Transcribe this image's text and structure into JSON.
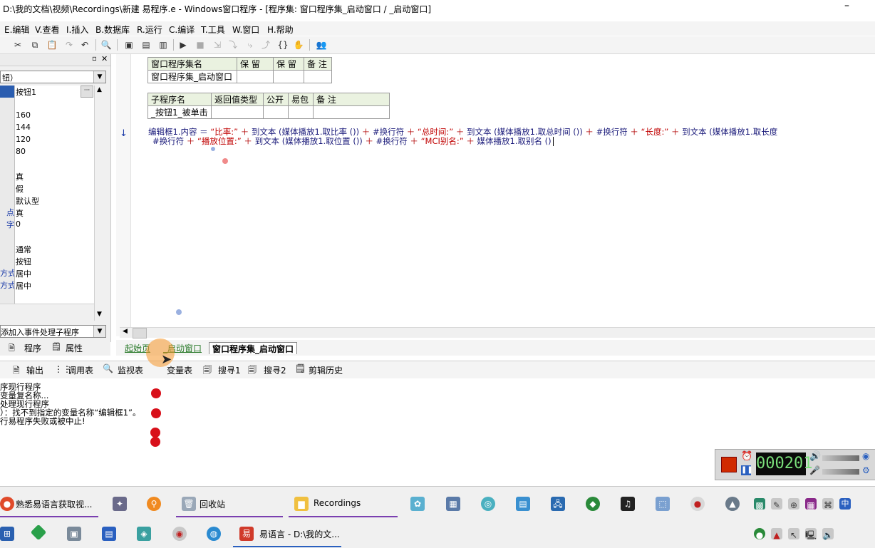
{
  "window": {
    "title": "D:\\我的文档\\视频\\Recordings\\新建 易程序.e - Windows窗口程序 - [程序集: 窗口程序集_启动窗口 / _启动窗口]",
    "minimize": "–"
  },
  "menu": [
    "E.编辑",
    "V.查看",
    "I.插入",
    "B.数据库",
    "R.运行",
    "C.编译",
    "T.工具",
    "W.窗口",
    "H.帮助"
  ],
  "left_panel": {
    "combo_value": "钮）",
    "properties": [
      {
        "key": "",
        "value": "按钮1",
        "selected": true
      },
      {
        "key": "",
        "value": ""
      },
      {
        "key": "",
        "value": "160"
      },
      {
        "key": "",
        "value": "144"
      },
      {
        "key": "",
        "value": "120"
      },
      {
        "key": "",
        "value": "80"
      },
      {
        "key": "",
        "value": ""
      },
      {
        "key": "",
        "value": "真"
      },
      {
        "key": "",
        "value": "假"
      },
      {
        "key": "",
        "value": "默认型"
      },
      {
        "key": "点",
        "value": "真"
      },
      {
        "key": "字",
        "value": "0"
      },
      {
        "key": "",
        "value": ""
      },
      {
        "key": "",
        "value": "通常"
      },
      {
        "key": "",
        "value": "按钮"
      },
      {
        "key": "方式",
        "value": "居中"
      },
      {
        "key": "方式",
        "value": "居中"
      },
      {
        "key": "",
        "value": ""
      }
    ],
    "event_combo": "添加入事件处理子程序",
    "tabs": [
      "程序",
      "属性"
    ],
    "ellipsis": "···"
  },
  "editor": {
    "assembly_table": {
      "headers": [
        "窗口程序集名",
        "保 留",
        "保 留",
        "备 注"
      ],
      "row": [
        "窗口程序集_启动窗口",
        "",
        "",
        ""
      ]
    },
    "sub_table": {
      "headers": [
        "子程序名",
        "返回值类型",
        "公开",
        "易包",
        "备 注"
      ],
      "row": [
        "_按钮1_被单击",
        "",
        "",
        "",
        ""
      ]
    },
    "code_line1": [
      {
        "t": "编辑框1.内容 ＝ ",
        "c": "kw"
      },
      {
        "t": "“比率:”",
        "c": "s"
      },
      {
        "t": " ＋ ",
        "c": "op"
      },
      {
        "t": "到文本 (媒体播放1.取比率 ()) ",
        "c": "kw"
      },
      {
        "t": "＋ ",
        "c": "op"
      },
      {
        "t": "#换行符 ",
        "c": "kw"
      },
      {
        "t": "＋ ",
        "c": "op"
      },
      {
        "t": "“总时间:”",
        "c": "s"
      },
      {
        "t": " ＋ ",
        "c": "op"
      },
      {
        "t": "到文本 (媒体播放1.取总时间 ()) ",
        "c": "kw"
      },
      {
        "t": "＋ ",
        "c": "op"
      },
      {
        "t": "#换行符 ",
        "c": "kw"
      },
      {
        "t": "＋ ",
        "c": "op"
      },
      {
        "t": "“长度:”",
        "c": "s"
      },
      {
        "t": " ＋ ",
        "c": "op"
      },
      {
        "t": "到文本 (媒体播放1.取长度",
        "c": "kw"
      }
    ],
    "code_line2": [
      {
        "t": "#换行符 ",
        "c": "kw"
      },
      {
        "t": "＋ ",
        "c": "op"
      },
      {
        "t": "“播放位置:”",
        "c": "s"
      },
      {
        "t": " ＋ ",
        "c": "op"
      },
      {
        "t": "到文本 (媒体播放1.取位置 ()) ",
        "c": "kw"
      },
      {
        "t": "＋ ",
        "c": "op"
      },
      {
        "t": "#换行符 ",
        "c": "kw"
      },
      {
        "t": "＋ ",
        "c": "op"
      },
      {
        "t": "“MCI别名:”",
        "c": "s"
      },
      {
        "t": " ＋ ",
        "c": "op"
      },
      {
        "t": "媒体播放1.取别名 ()",
        "c": "kw"
      }
    ],
    "arrow": "↓"
  },
  "editor_tabs": [
    "起始页",
    "_启动窗口",
    "窗口程序集_启动窗口"
  ],
  "output_tabs": [
    "输出",
    "调用表",
    "监视表",
    "变量表",
    "搜寻1",
    "搜寻2",
    "剪辑历史"
  ],
  "output_lines": [
    "序现行程序",
    "变量复名称...",
    "处理现行程序",
    "）：找不到指定的变量名称“编辑框1”。",
    "行易程序失败或被中止!"
  ],
  "recorder": {
    "time": "000201"
  },
  "taskbar": {
    "row1": [
      "熟悉易语言获取视...",
      "回收站",
      "Recordings"
    ],
    "row2": [
      "易语言 - D:\\我的文..."
    ],
    "ime": "中"
  }
}
